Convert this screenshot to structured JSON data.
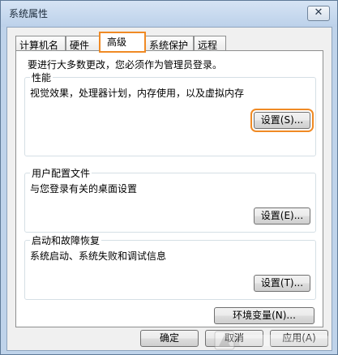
{
  "window": {
    "title": "系统属性",
    "close_label": "✕"
  },
  "tabs": [
    {
      "label": "计算机名"
    },
    {
      "label": "硬件"
    },
    {
      "label": "高级"
    },
    {
      "label": "系统保护"
    },
    {
      "label": "远程"
    }
  ],
  "advanced": {
    "notice": "要进行大多数更改，您必须作为管理员登录。",
    "performance": {
      "title": "性能",
      "desc": "视觉效果，处理器计划，内存使用，以及虚拟内存",
      "button": "设置(S)..."
    },
    "user_profiles": {
      "title": "用户配置文件",
      "desc": "与您登录有关的桌面设置",
      "button": "设置(E)..."
    },
    "startup_recovery": {
      "title": "启动和故障恢复",
      "desc": "系统启动、系统失败和调试信息",
      "button": "设置(T)..."
    },
    "env_button": "环境变量(N)..."
  },
  "footer": {
    "ok": "确定",
    "cancel": "取消",
    "apply": "应用(A)"
  },
  "colors": {
    "highlight": "#f08a24",
    "title_bar": "#bcd1ea"
  }
}
